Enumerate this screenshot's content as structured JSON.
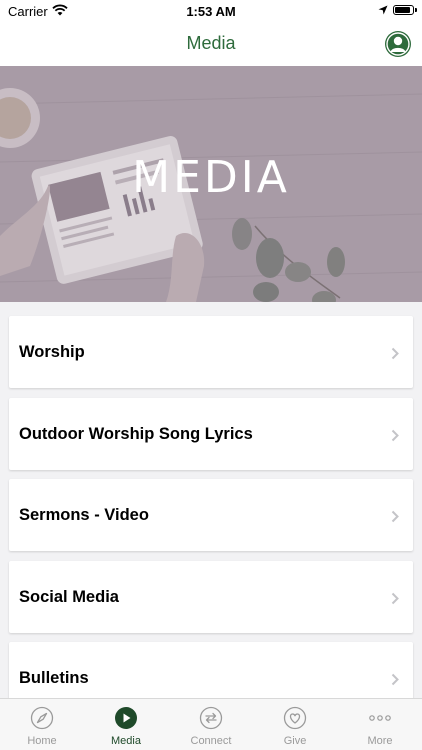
{
  "status_bar": {
    "carrier": "Carrier",
    "time": "1:53 AM"
  },
  "nav": {
    "title": "Media"
  },
  "hero": {
    "title": "MEDIA"
  },
  "items": [
    {
      "label": "Worship"
    },
    {
      "label": "Outdoor Worship Song Lyrics"
    },
    {
      "label": "Sermons - Video"
    },
    {
      "label": "Social Media"
    },
    {
      "label": "Bulletins"
    }
  ],
  "tabs": [
    {
      "label": "Home",
      "icon": "compass-icon"
    },
    {
      "label": "Media",
      "icon": "play-icon",
      "active": true
    },
    {
      "label": "Connect",
      "icon": "arrows-icon"
    },
    {
      "label": "Give",
      "icon": "heart-icon"
    },
    {
      "label": "More",
      "icon": "ellipsis-icon"
    }
  ],
  "colors": {
    "accent": "#2e6b3c",
    "active_tab": "#1f4a2a",
    "inactive_tab": "#9a9a9a"
  }
}
